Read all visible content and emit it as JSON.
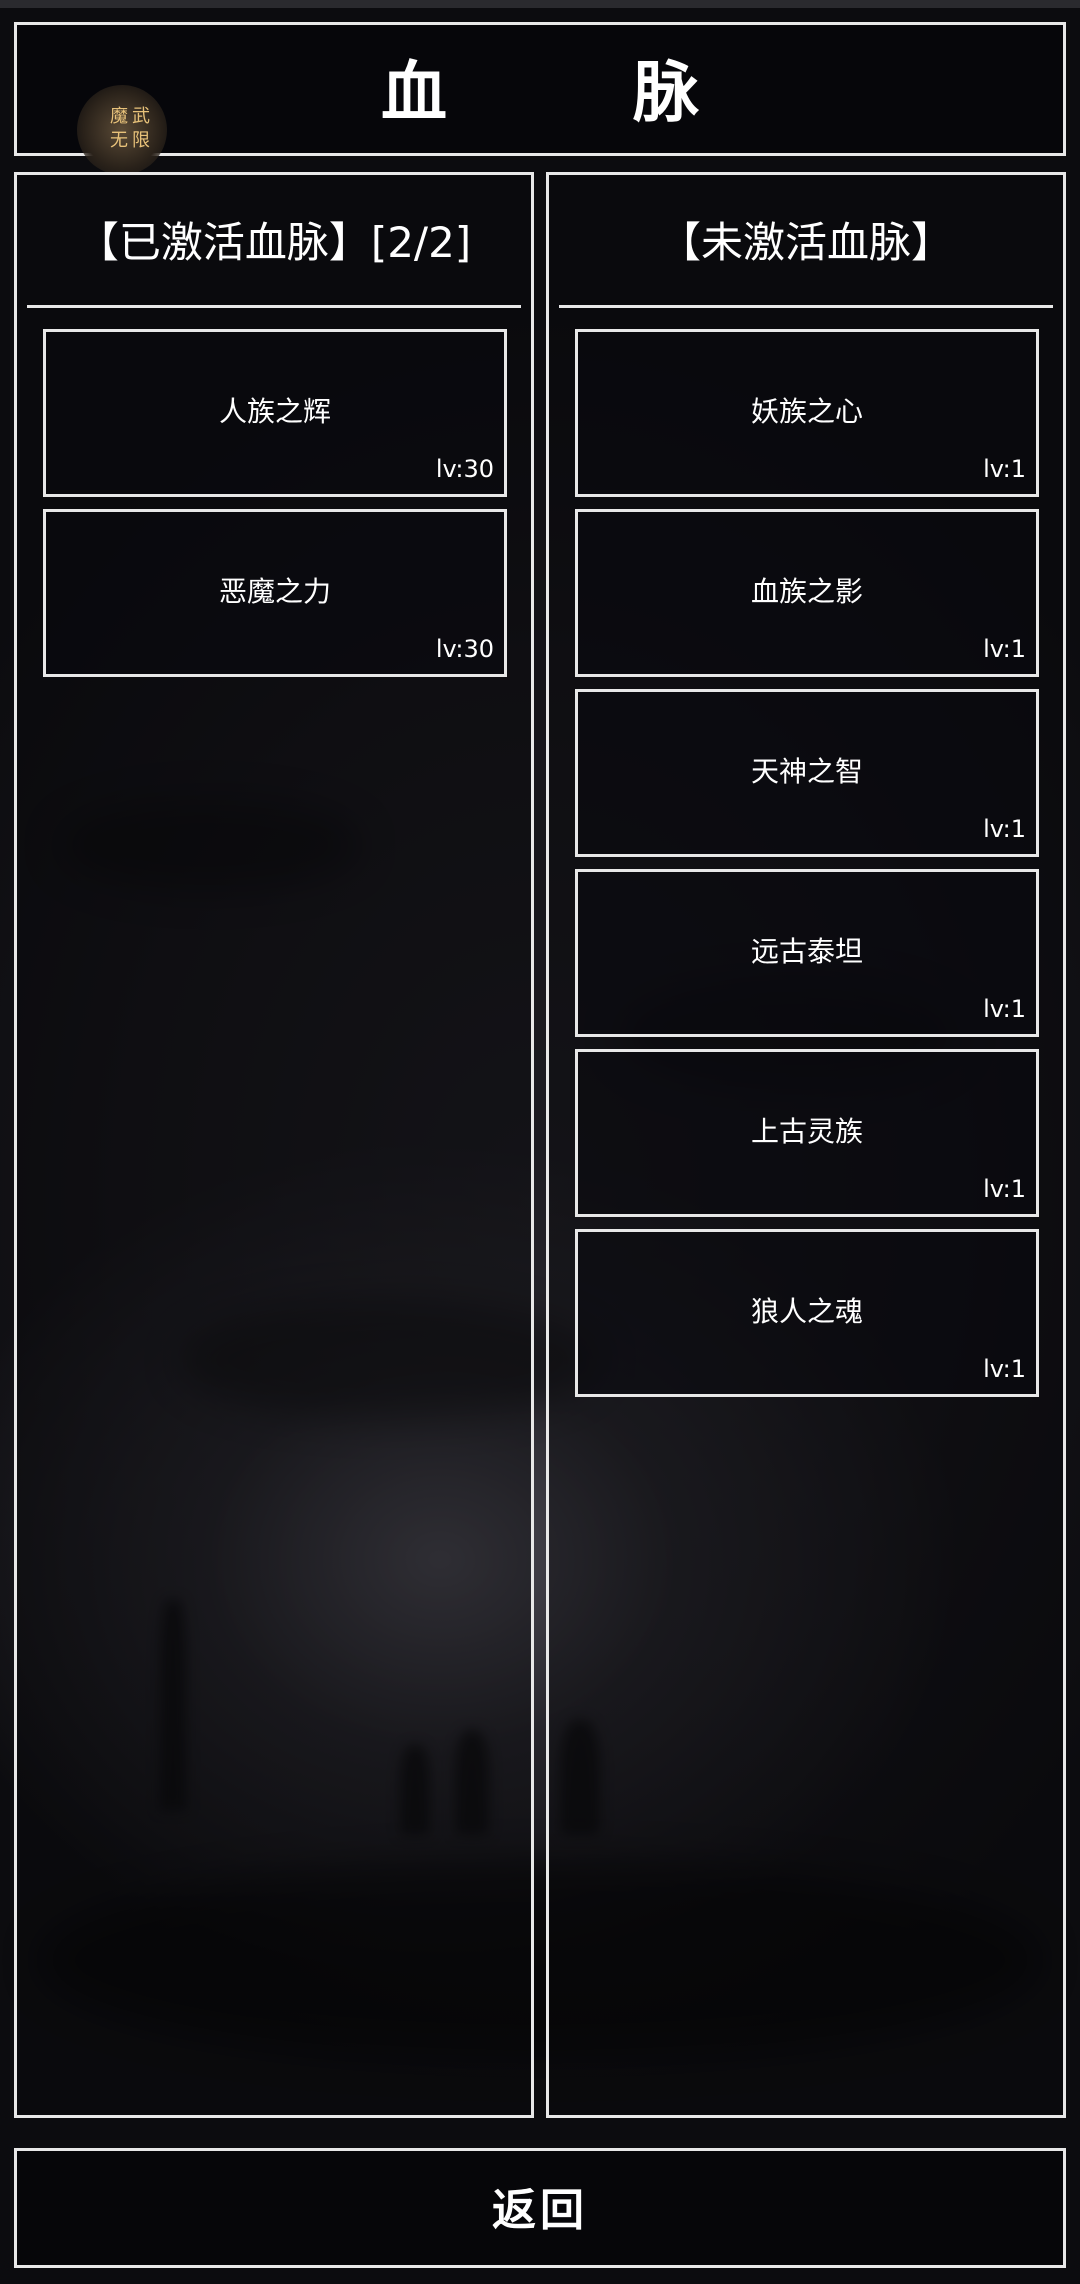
{
  "header": {
    "title": "血　脉",
    "logo_text": "魔武无限"
  },
  "activated": {
    "title": "【已激活血脉】[2/2]",
    "items": [
      {
        "name": "人族之辉",
        "level": "lv:30"
      },
      {
        "name": "恶魔之力",
        "level": "lv:30"
      }
    ]
  },
  "inactive": {
    "title": "【未激活血脉】",
    "items": [
      {
        "name": "妖族之心",
        "level": "lv:1"
      },
      {
        "name": "血族之影",
        "level": "lv:1"
      },
      {
        "name": "天神之智",
        "level": "lv:1"
      },
      {
        "name": "远古泰坦",
        "level": "lv:1"
      },
      {
        "name": "上古灵族",
        "level": "lv:1"
      },
      {
        "name": "狼人之魂",
        "level": "lv:1"
      }
    ]
  },
  "footer": {
    "back_label": "返回"
  },
  "colors": {
    "border": "#e8e8e8",
    "text": "#ffffff",
    "background": "#141318",
    "logo_gold": "#e8c27a"
  }
}
